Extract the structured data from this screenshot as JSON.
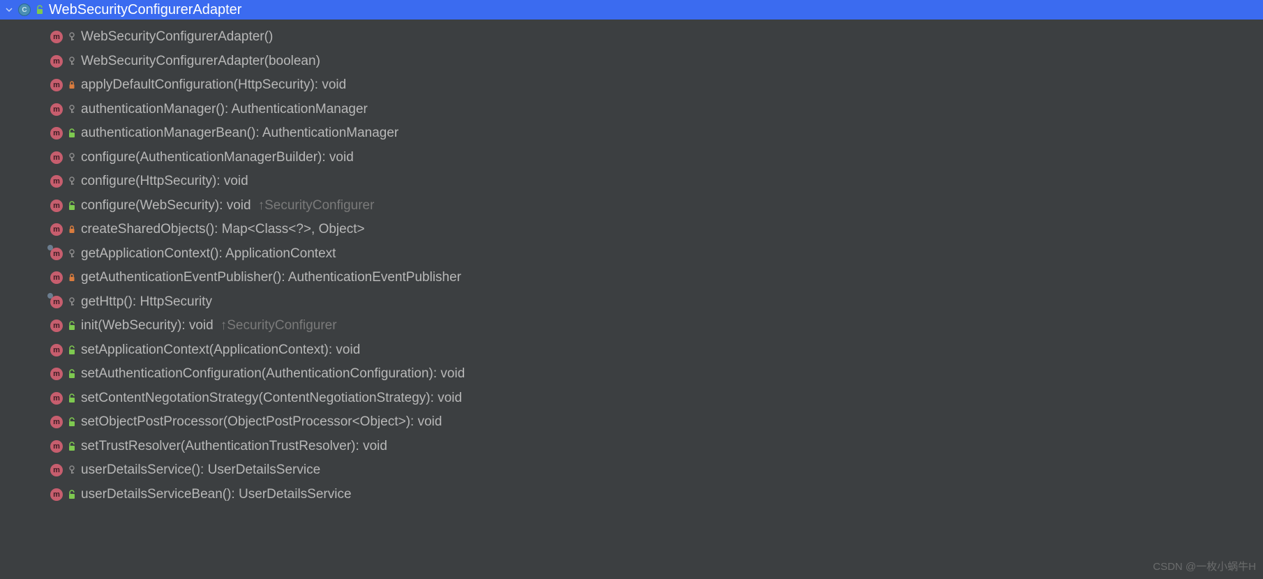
{
  "header": {
    "className": "WebSecurityConfigurerAdapter"
  },
  "methods": [
    {
      "signature": "WebSecurityConfigurerAdapter()",
      "access": "key",
      "override": false,
      "inherited": null
    },
    {
      "signature": "WebSecurityConfigurerAdapter(boolean)",
      "access": "key",
      "override": false,
      "inherited": null
    },
    {
      "signature": "applyDefaultConfiguration(HttpSecurity): void",
      "access": "lock",
      "override": false,
      "inherited": null
    },
    {
      "signature": "authenticationManager(): AuthenticationManager",
      "access": "key",
      "override": false,
      "inherited": null
    },
    {
      "signature": "authenticationManagerBean(): AuthenticationManager",
      "access": "unlock",
      "override": false,
      "inherited": null
    },
    {
      "signature": "configure(AuthenticationManagerBuilder): void",
      "access": "key",
      "override": false,
      "inherited": null
    },
    {
      "signature": "configure(HttpSecurity): void",
      "access": "key",
      "override": false,
      "inherited": null
    },
    {
      "signature": "configure(WebSecurity): void",
      "access": "unlock",
      "override": false,
      "inherited": "↑SecurityConfigurer"
    },
    {
      "signature": "createSharedObjects(): Map<Class<?>, Object>",
      "access": "lock",
      "override": false,
      "inherited": null
    },
    {
      "signature": "getApplicationContext(): ApplicationContext",
      "access": "key",
      "override": true,
      "inherited": null
    },
    {
      "signature": "getAuthenticationEventPublisher(): AuthenticationEventPublisher",
      "access": "lock",
      "override": false,
      "inherited": null
    },
    {
      "signature": "getHttp(): HttpSecurity",
      "access": "key",
      "override": true,
      "inherited": null
    },
    {
      "signature": "init(WebSecurity): void",
      "access": "unlock",
      "override": false,
      "inherited": "↑SecurityConfigurer"
    },
    {
      "signature": "setApplicationContext(ApplicationContext): void",
      "access": "unlock",
      "override": false,
      "inherited": null
    },
    {
      "signature": "setAuthenticationConfiguration(AuthenticationConfiguration): void",
      "access": "unlock",
      "override": false,
      "inherited": null
    },
    {
      "signature": "setContentNegotationStrategy(ContentNegotiationStrategy): void",
      "access": "unlock",
      "override": false,
      "inherited": null
    },
    {
      "signature": "setObjectPostProcessor(ObjectPostProcessor<Object>): void",
      "access": "unlock",
      "override": false,
      "inherited": null
    },
    {
      "signature": "setTrustResolver(AuthenticationTrustResolver): void",
      "access": "unlock",
      "override": false,
      "inherited": null
    },
    {
      "signature": "userDetailsService(): UserDetailsService",
      "access": "key",
      "override": false,
      "inherited": null
    },
    {
      "signature": "userDetailsServiceBean(): UserDetailsService",
      "access": "unlock",
      "override": false,
      "inherited": null
    }
  ],
  "watermark": "CSDN @一枚小蜗牛H",
  "icons": {
    "methodLetter": "m",
    "classLetter": "C"
  }
}
